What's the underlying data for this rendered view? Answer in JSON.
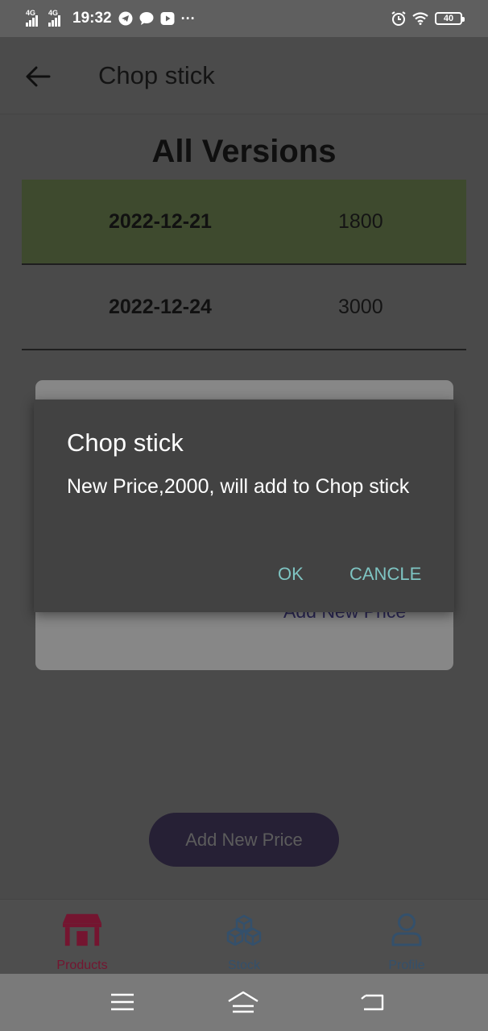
{
  "status_bar": {
    "network_1": "4G",
    "network_2": "4G",
    "time": "19:32",
    "more": "···",
    "battery": "40"
  },
  "app_bar": {
    "title": "Chop stick"
  },
  "section_title": "All Versions",
  "versions": [
    {
      "date": "2022-12-21",
      "price": "1800",
      "selected": true
    },
    {
      "date": "2022-12-24",
      "price": "3000",
      "selected": false
    }
  ],
  "background_card": {
    "link_label": "Add New Price"
  },
  "dialog": {
    "title": "Chop stick",
    "message": "New Price,2000, will add to Chop stick",
    "ok_label": "OK",
    "cancel_label": "CANCLE"
  },
  "add_button_label": "Add New Price",
  "bottom_nav": [
    {
      "label": "Products",
      "icon": "store-icon",
      "active": true
    },
    {
      "label": "Stock",
      "icon": "boxes-icon",
      "active": false
    },
    {
      "label": "Profile",
      "icon": "person-icon",
      "active": false
    }
  ],
  "colors": {
    "active_nav": "#741530",
    "inactive_nav": "#34506b",
    "dialog_button": "#7ec4c2",
    "selected_row": "#3e4a2e"
  }
}
